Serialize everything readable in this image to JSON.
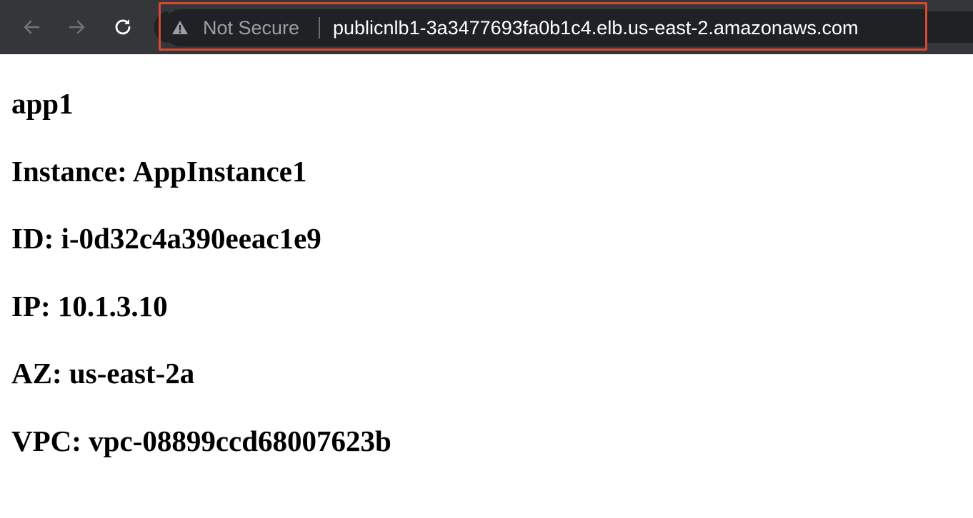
{
  "browser": {
    "security_label": "Not Secure",
    "url": "publicnlb1-3a3477693fa0b1c4.elb.us-east-2.amazonaws.com",
    "icons": {
      "back": "back-arrow-icon",
      "forward": "forward-arrow-icon",
      "reload": "reload-icon",
      "warning": "warning-triangle-icon"
    },
    "highlight_color": "#d9482f"
  },
  "page": {
    "title": "app1",
    "instance": "Instance: AppInstance1",
    "id": "ID: i-0d32c4a390eeac1e9",
    "ip": "IP: 10.1.3.10",
    "az": "AZ: us-east-2a",
    "vpc": "VPC: vpc-08899ccd68007623b"
  }
}
